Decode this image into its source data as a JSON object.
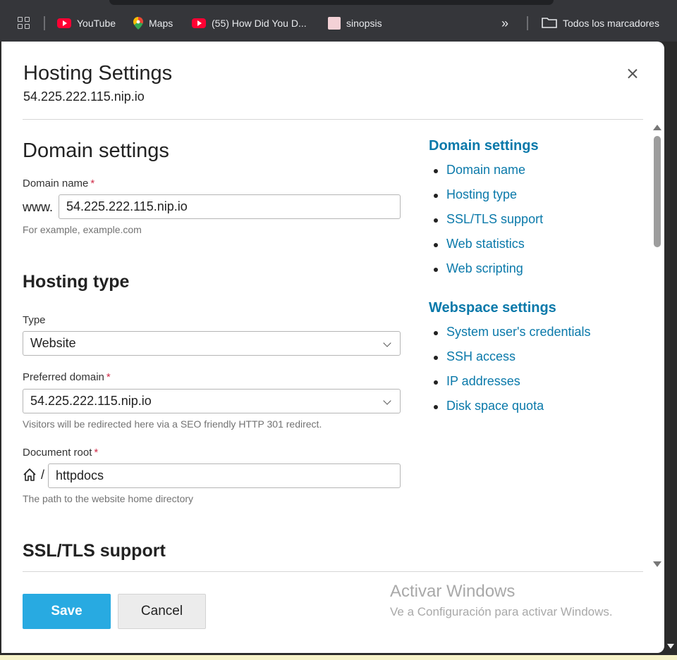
{
  "bookmarks": {
    "items": [
      {
        "label": "YouTube",
        "icon": "youtube-icon"
      },
      {
        "label": "Maps",
        "icon": "maps-icon"
      },
      {
        "label": "(55) How Did You D...",
        "icon": "youtube-icon"
      },
      {
        "label": "sinopsis",
        "icon": "sinopsis-icon"
      }
    ],
    "all_bookmarks": "Todos los marcadores",
    "overflow": "»"
  },
  "modal": {
    "title": "Hosting Settings",
    "subtitle": "54.225.222.115.nip.io"
  },
  "form": {
    "domain_section": "Domain settings",
    "domain_name_label": "Domain name",
    "required_mark": "*",
    "www_prefix": "www.",
    "domain_value": "54.225.222.115.nip.io",
    "domain_hint": "For example, example.com",
    "hosting_section": "Hosting type",
    "type_label": "Type",
    "type_value": "Website",
    "preferred_label": "Preferred domain",
    "preferred_value": "54.225.222.115.nip.io",
    "preferred_hint": "Visitors will be redirected here via a SEO friendly HTTP 301 redirect.",
    "docroot_label": "Document root",
    "docroot_slash": "/",
    "docroot_value": "httpdocs",
    "docroot_hint": "The path to the website home directory",
    "ssl_section": "SSL/TLS support"
  },
  "toc": {
    "domain_heading": "Domain settings",
    "domain_items": [
      "Domain name",
      "Hosting type",
      "SSL/TLS support",
      "Web statistics",
      "Web scripting"
    ],
    "webspace_heading": "Webspace settings",
    "webspace_items": [
      "System user's credentials",
      "SSH access",
      "IP addresses",
      "Disk space quota"
    ]
  },
  "buttons": {
    "save": "Save",
    "cancel": "Cancel"
  },
  "watermark": {
    "title": "Activar Windows",
    "subtitle": "Ve a Configuración para activar Windows."
  },
  "colors": {
    "accent": "#28aae1",
    "link": "#0a79aa",
    "required": "#d02c48"
  }
}
